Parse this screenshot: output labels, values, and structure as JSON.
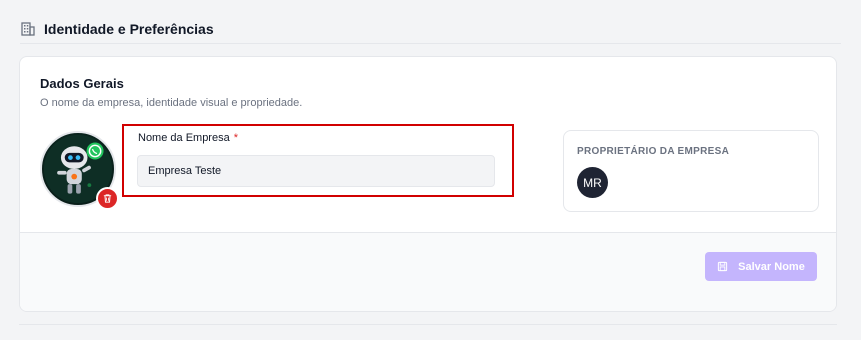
{
  "section": {
    "title": "Identidade e Preferências",
    "icon": "building-icon"
  },
  "card": {
    "title": "Dados Gerais",
    "subtitle": "O nome da empresa, identidade visual e propriedade."
  },
  "logo": {
    "icon": "robot-whatsapp-logo",
    "delete_icon": "trash-icon"
  },
  "company_name": {
    "label": "Nome da Empresa",
    "required_mark": "*",
    "value": "Empresa Teste"
  },
  "owner": {
    "label": "PROPRIETÁRIO DA EMPRESA",
    "initials": "MR"
  },
  "actions": {
    "save_label": "Salvar Nome",
    "save_icon": "save-icon"
  },
  "colors": {
    "required": "#dc2626",
    "highlight": "#d10000",
    "save_button_disabled": "#c4b5fd",
    "owner_avatar_bg": "#1f2433"
  }
}
